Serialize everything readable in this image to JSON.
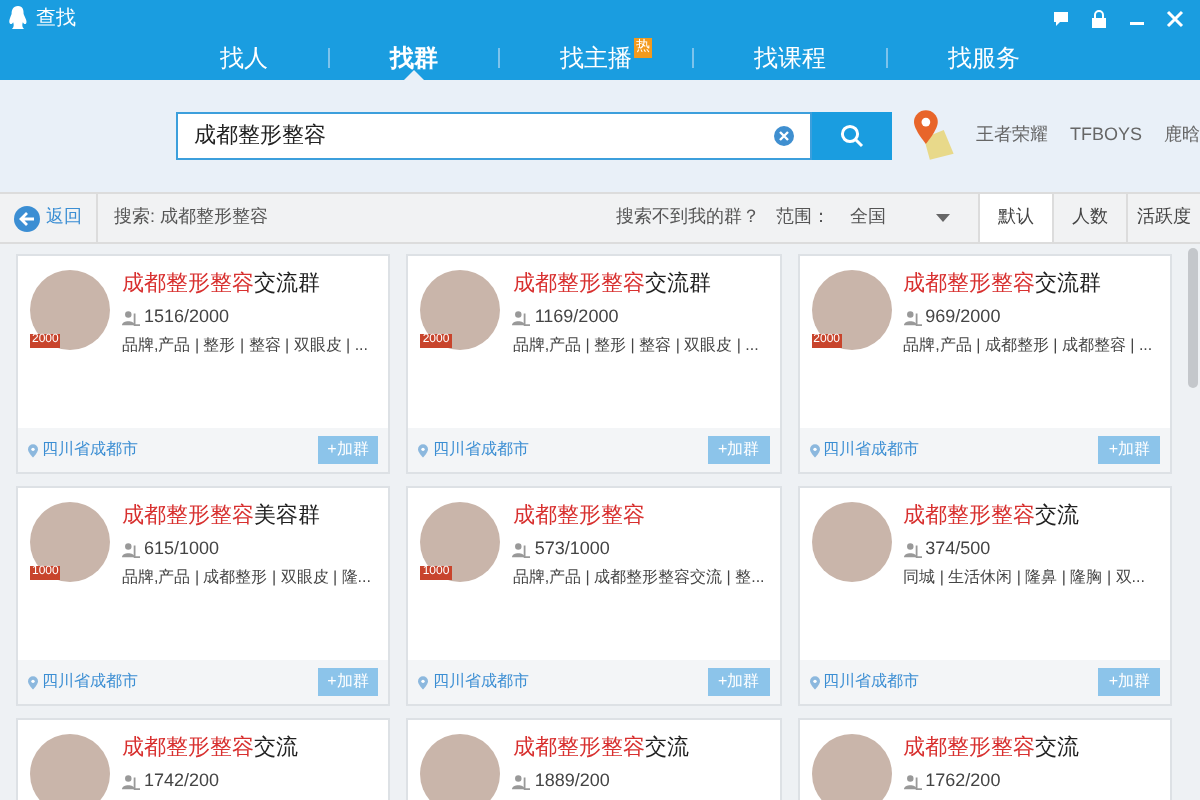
{
  "window": {
    "title": "查找"
  },
  "tabs": [
    {
      "label": "找人",
      "selected": false
    },
    {
      "label": "找群",
      "selected": true
    },
    {
      "label": "找主播",
      "selected": false,
      "badge": "热"
    },
    {
      "label": "找课程",
      "selected": false
    },
    {
      "label": "找服务",
      "selected": false
    }
  ],
  "search": {
    "value": "成都整形整容"
  },
  "hot_keywords": [
    "王者荣耀",
    "TFBOYS",
    "鹿晗"
  ],
  "filter_bar": {
    "back": "返回",
    "query": "搜索: 成都整形整容",
    "not_found": "搜索不到我的群？",
    "range_label": "范围：",
    "range_value": "全国",
    "sorts": [
      {
        "label": "默认",
        "selected": true
      },
      {
        "label": "人数",
        "selected": false
      },
      {
        "label": "活跃度",
        "selected": false
      }
    ]
  },
  "groups": [
    {
      "name_highlight": "成都整形整容",
      "name_rest": "交流群",
      "badge": "2000",
      "members": "1516/2000",
      "tags": "品牌,产品 | 整形 | 整容 | 双眼皮 | ...",
      "location": "四川省成都市",
      "join": "+加群"
    },
    {
      "name_highlight": "成都整形整容",
      "name_rest": "交流群",
      "badge": "2000",
      "members": "1169/2000",
      "tags": "品牌,产品 | 整形 | 整容 | 双眼皮 | ...",
      "location": "四川省成都市",
      "join": "+加群"
    },
    {
      "name_highlight": "成都整形整容",
      "name_rest": "交流群",
      "badge": "2000",
      "members": "969/2000",
      "tags": "品牌,产品 | 成都整形 | 成都整容 | ...",
      "location": "四川省成都市",
      "join": "+加群"
    },
    {
      "name_highlight": "成都整形整容",
      "name_rest": "美容群",
      "badge": "1000",
      "members": "615/1000",
      "tags": "品牌,产品 | 成都整形 | 双眼皮 | 隆...",
      "location": "四川省成都市",
      "join": "+加群"
    },
    {
      "name_highlight": "成都整形整容",
      "badge": "1000",
      "members": "573/1000",
      "tags": "品牌,产品 | 成都整形整容交流 | 整...",
      "location": "四川省成都市",
      "join": "+加群"
    },
    {
      "name_highlight": "成都整形整容",
      "name_rest": "交流",
      "members": "374/500",
      "tags": "同城 | 生活休闲 | 隆鼻 | 隆胸 | 双...",
      "location": "四川省成都市",
      "join": "+加群"
    },
    {
      "name_highlight": "成都整形整容",
      "name_rest": "交流",
      "members": "1742/200"
    },
    {
      "name_highlight": "成都整形整容",
      "name_rest": "交流",
      "members": "1889/200"
    },
    {
      "name_highlight": "成都整形整容",
      "name_rest": "交流",
      "members": "1762/200"
    }
  ]
}
